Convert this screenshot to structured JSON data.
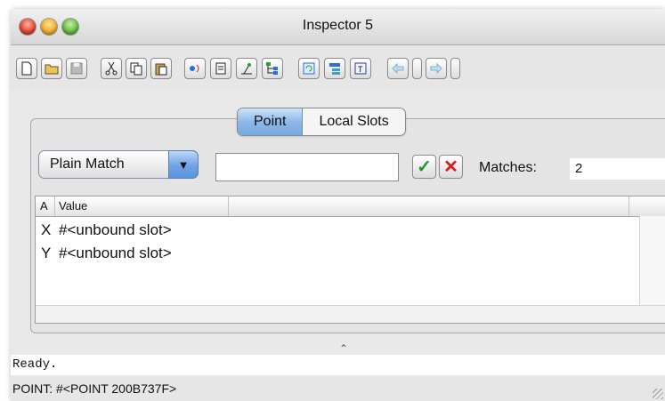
{
  "window": {
    "title": "Inspector 5"
  },
  "toolbar": {
    "buttons": [
      {
        "name": "new-document-icon"
      },
      {
        "name": "open-folder-icon"
      },
      {
        "name": "save-disk-icon"
      },
      {
        "name": "cut-scissors-icon"
      },
      {
        "name": "copy-icon"
      },
      {
        "name": "paste-icon"
      },
      {
        "name": "evaluate-icon"
      },
      {
        "name": "describe-icon"
      },
      {
        "name": "inspect-icon"
      },
      {
        "name": "class-tree-icon"
      },
      {
        "name": "refresh-icon"
      },
      {
        "name": "tree-browser-icon"
      },
      {
        "name": "type-icon"
      },
      {
        "name": "back-arrow-icon"
      },
      {
        "name": "forward-arrow-icon"
      }
    ]
  },
  "tabs": [
    {
      "label": "Point",
      "active": true
    },
    {
      "label": "Local Slots",
      "active": false
    }
  ],
  "filter": {
    "mode": "Plain Match",
    "text": "",
    "matches_label": "Matches:",
    "matches_value": "2"
  },
  "table": {
    "columns": [
      "A",
      "Value"
    ],
    "rows": [
      {
        "a": "X",
        "value": "#<unbound slot>"
      },
      {
        "a": "Y",
        "value": "#<unbound slot>"
      }
    ]
  },
  "status": {
    "message": "Ready.",
    "footer": "POINT: #<POINT 200B737F>"
  },
  "colors": {
    "accent": "#78a8e2",
    "ok": "#23952c",
    "cancel": "#d91c1c"
  }
}
